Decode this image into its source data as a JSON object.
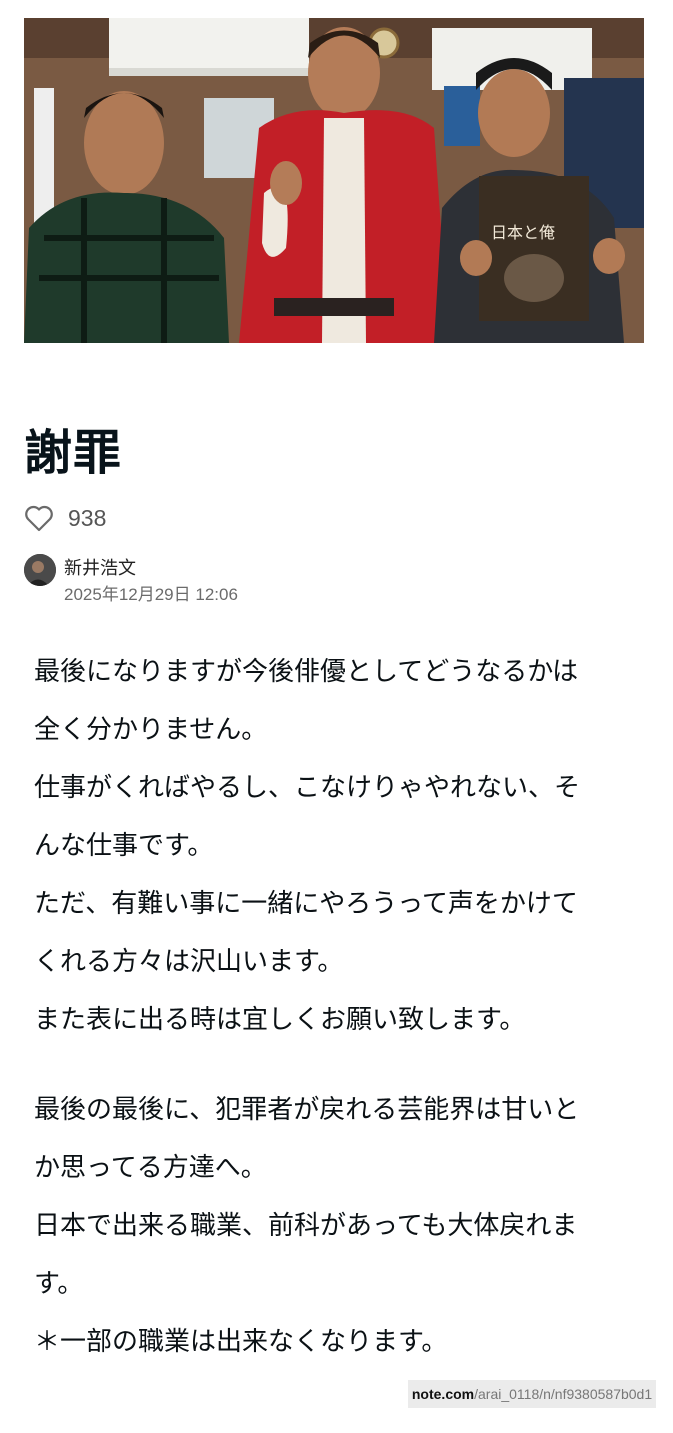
{
  "article": {
    "title": "謝罪",
    "likes": "938",
    "hero_photo_book_text": "日本と俺"
  },
  "author": {
    "name": "新井浩文",
    "date": "2025年12月29日 12:06"
  },
  "body": {
    "lines": [
      "最後になりますが今後俳優としてどうなるかは",
      "全く分かりません。",
      "仕事がくればやるし、こなけりゃやれない、そ",
      "んな仕事です。",
      "ただ、有難い事に一緒にやろうって声をかけて",
      "くれる方々は沢山います。",
      "また表に出る時は宜しくお願い致します。",
      "最後の最後に、犯罪者が戻れる芸能界は甘いと",
      "か思ってる方達へ。",
      "日本で出来る職業、前科があっても大体戻れま",
      "す。",
      "＊一部の職業は出来なくなります。"
    ]
  },
  "source": {
    "domain": "note.com",
    "path": "/arai_0118/n/nf9380587b0d1"
  },
  "colors": {
    "text": "#08131a",
    "muted": "#6b6b6b",
    "badge_bg": "#ebebeb"
  },
  "icons": {
    "like": "heart-outline-icon"
  }
}
